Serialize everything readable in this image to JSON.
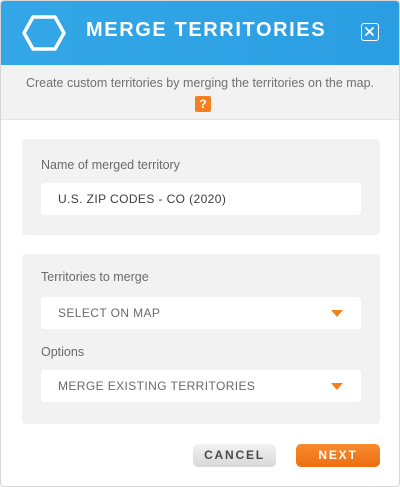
{
  "dialog": {
    "title": "MERGE TERRITORIES",
    "close_icon": "close-icon",
    "header_icon": "hexagon-icon",
    "description": "Create custom territories by merging the territories on the map.",
    "help_label": "?"
  },
  "name_section": {
    "label": "Name of merged territory",
    "value": "U.S. ZIP CODES - CO (2020)"
  },
  "merge_section": {
    "territories_label": "Territories to merge",
    "territories_value": "SELECT ON MAP",
    "options_label": "Options",
    "options_value": "MERGE EXISTING TERRITORIES"
  },
  "buttons": {
    "cancel": "CANCEL",
    "next": "NEXT"
  },
  "colors": {
    "header": "#2ea2e4",
    "accent": "#f48120",
    "panel": "#f2f2f2"
  }
}
